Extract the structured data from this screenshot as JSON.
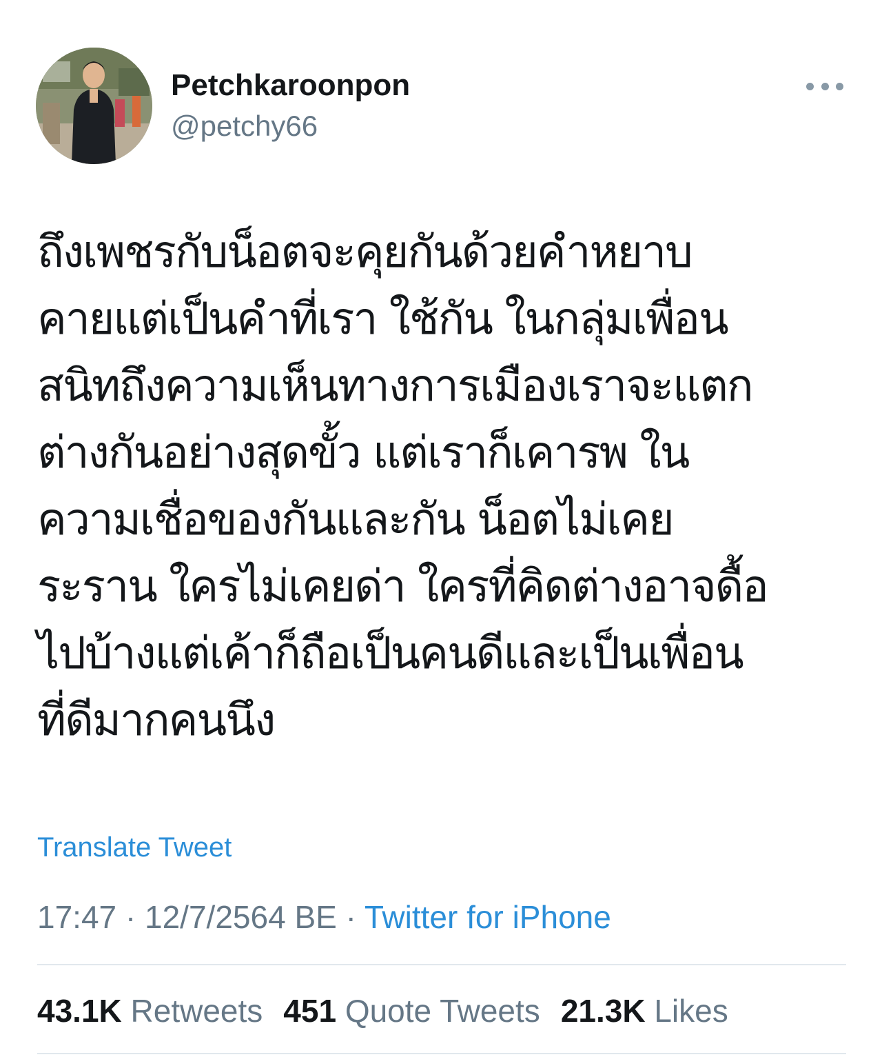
{
  "user": {
    "display_name": "Petchkaroonpon",
    "handle": "@petchy66"
  },
  "tweet": {
    "lines": [
      "ถึงเพชรกับน็อตจะคุยกันด้วยคำหยาบ",
      "คายแต่เป็นคำที่เรา ใช้กัน ในกลุ่มเพื่อน",
      "สนิทถึงความเห็นทางการเมืองเราจะแตก",
      "ต่างกันอย่างสุดขั้ว แต่เราก็เคารพ ใน",
      "ความเชื่อของกันและกัน น็อตไม่เคย",
      "ระราน ใครไม่เคยด่า ใครที่คิดต่างอาจดื้อ",
      "ไปบ้างแต่เค้าก็ถือเป็นคนดีและเป็นเพื่อน",
      "ที่ดีมากคนนึง"
    ],
    "translate_label": "Translate Tweet",
    "time": "17:47",
    "separator": "·",
    "date": "12/7/2564 BE",
    "source": "Twitter for iPhone"
  },
  "stats": {
    "retweets_count": "43.1K",
    "retweets_label": "Retweets",
    "quotes_count": "451",
    "quotes_label": "Quote Tweets",
    "likes_count": "21.3K",
    "likes_label": "Likes"
  },
  "icons": {
    "more": "more-horizontal-icon",
    "avatar": "profile-photo"
  },
  "colors": {
    "text": "#14171a",
    "secondary": "#657786",
    "link": "#2b8ed8",
    "divider": "#e1e8ed"
  }
}
